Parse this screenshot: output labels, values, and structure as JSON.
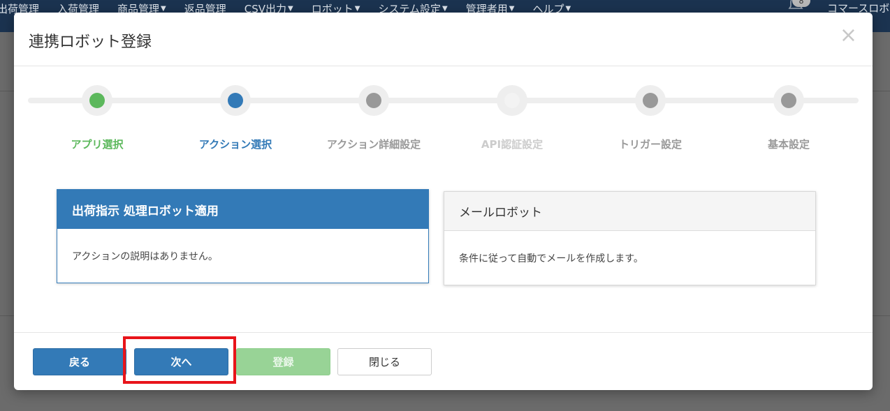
{
  "navbar": {
    "items": [
      {
        "label": "出荷管理",
        "dropdown": false
      },
      {
        "label": "入荷管理",
        "dropdown": false
      },
      {
        "label": "商品管理",
        "dropdown": true
      },
      {
        "label": "返品管理",
        "dropdown": false
      },
      {
        "label": "CSV出力",
        "dropdown": true
      },
      {
        "label": "ロボット",
        "dropdown": true
      },
      {
        "label": "システム設定",
        "dropdown": true
      },
      {
        "label": "管理者用",
        "dropdown": true
      },
      {
        "label": "ヘルプ",
        "dropdown": true
      }
    ],
    "notification_count": "8",
    "user_label": "コマースロボ",
    "bg_color": "#1b3350"
  },
  "modal": {
    "title": "連携ロボット登録",
    "close_glyph": "×"
  },
  "stepper": {
    "steps": [
      {
        "label": "アプリ選択",
        "state": "done",
        "color": "#5cb85c"
      },
      {
        "label": "アクション選択",
        "state": "current",
        "color": "#337ab7"
      },
      {
        "label": "アクション詳細設定",
        "state": "pending",
        "color": "#999999"
      },
      {
        "label": "API認証設定",
        "state": "disabled",
        "color": "#cccccc"
      },
      {
        "label": "トリガー設定",
        "state": "pending",
        "color": "#999999"
      },
      {
        "label": "基本設定",
        "state": "pending",
        "color": "#999999"
      }
    ]
  },
  "cards": [
    {
      "title": "出荷指示 処理ロボット適用",
      "description": "アクションの説明はありません。",
      "selected": true
    },
    {
      "title": "メールロボット",
      "description": "条件に従って自動でメールを作成します。",
      "selected": false
    }
  ],
  "footer": {
    "back_label": "戻る",
    "next_label": "次へ",
    "register_label": "登録",
    "close_label": "閉じる"
  },
  "colors": {
    "primary": "#337ab7",
    "success_disabled": "#98d396",
    "highlight": "#e8141a"
  }
}
